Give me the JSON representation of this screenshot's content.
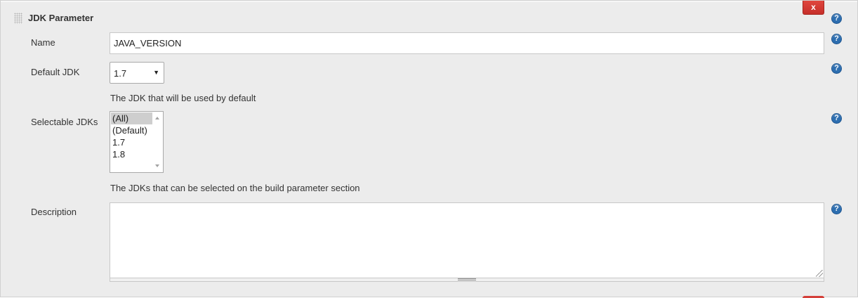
{
  "section": {
    "title": "JDK Parameter",
    "close_label": "x"
  },
  "help_label": "?",
  "fields": {
    "name": {
      "label": "Name",
      "value": "JAVA_VERSION"
    },
    "default_jdk": {
      "label": "Default JDK",
      "selected": "1.7",
      "arrow": "▼",
      "hint": "The JDK that will be used by default"
    },
    "selectable_jdks": {
      "label": "Selectable JDKs",
      "options": [
        "(All)",
        "(Default)",
        "1.7",
        "1.8"
      ],
      "selected_index": 0,
      "hint": "The JDKs that can be selected on the build parameter section"
    },
    "description": {
      "label": "Description",
      "value": ""
    }
  },
  "colors": {
    "panel_bg": "#ececec",
    "close_button": "#c9302c",
    "help_icon": "#2d6eb0"
  }
}
